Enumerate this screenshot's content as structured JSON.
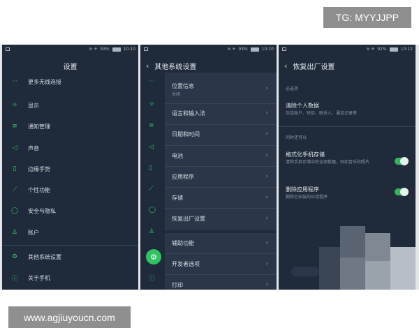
{
  "watermarks": {
    "top": "TG: MYYJJPP",
    "bottom": "www.agjiuyoucn.com"
  },
  "screen1": {
    "status": {
      "battery": "93%",
      "time": "10:10"
    },
    "title": "设置",
    "items": [
      {
        "icon": "more-icon",
        "glyph": "···",
        "label": "更多无线连接"
      },
      {
        "icon": "display-icon",
        "glyph": "☼",
        "label": "显示"
      },
      {
        "icon": "notification-icon",
        "glyph": "≡",
        "label": "通知管理"
      },
      {
        "icon": "sound-icon",
        "glyph": "◁",
        "label": "声音"
      },
      {
        "icon": "edge-gesture-icon",
        "glyph": "▯",
        "label": "边缘手势"
      },
      {
        "icon": "personal-icon",
        "glyph": "⟋",
        "label": "个性功能"
      },
      {
        "icon": "shield-icon",
        "glyph": "◯",
        "label": "安全与隐私"
      },
      {
        "icon": "account-icon",
        "glyph": "♙",
        "label": "账户"
      },
      {
        "icon": "gear-icon",
        "glyph": "⚙",
        "label": "其他系统设置"
      },
      {
        "icon": "info-icon",
        "glyph": "ⓘ",
        "label": "关于手机"
      }
    ]
  },
  "screen2": {
    "status": {
      "battery": "93%",
      "time": "10:10"
    },
    "title": "其他系统设置",
    "items": [
      {
        "label": "位置信息",
        "sub": "关闭"
      },
      {
        "label": "语言和输入法"
      },
      {
        "label": "日期和时间"
      },
      {
        "label": "电池"
      },
      {
        "label": "应用程序"
      },
      {
        "label": "存储"
      },
      {
        "label": "恢复出厂设置"
      },
      {
        "label": "辅助功能"
      },
      {
        "label": "开发者选项"
      },
      {
        "label": "打印"
      }
    ]
  },
  "screen3": {
    "status": {
      "battery": "92%",
      "time": "10:12"
    },
    "title": "恢复出厂设置",
    "section1": "必选项",
    "clear": {
      "title": "清除个人数据",
      "sub": "包括账户、短信、联系人、通话记录等"
    },
    "section2": "同时还可以",
    "format": {
      "title": "格式化手机存储",
      "sub": "清除手机存储中的全部数据，例如音乐和照片",
      "on": true
    },
    "delete_apps": {
      "title": "删除应用程序",
      "sub": "删除已安装的应用程序",
      "on": true
    }
  },
  "colors": {
    "accent": "#3cc36a",
    "bg": "#1f2b3b",
    "panel": "#2b3749"
  }
}
